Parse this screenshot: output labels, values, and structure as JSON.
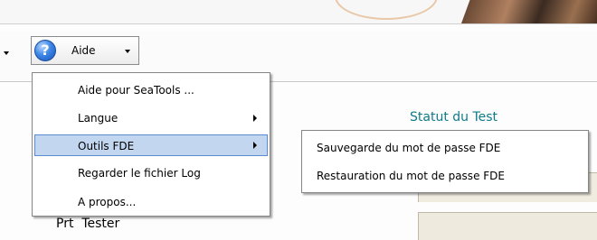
{
  "toolbar": {
    "aide_label": "Aide"
  },
  "background": {
    "status_title": "Statut du Test",
    "row_label": "Prt  Tester"
  },
  "menu": {
    "items": [
      {
        "label": "Aide pour SeaTools ...",
        "has_submenu": false
      },
      {
        "label": "Langue",
        "has_submenu": true
      },
      {
        "label": "Outils FDE",
        "has_submenu": true,
        "highlighted": true
      },
      {
        "label": "Regarder le fichier Log",
        "has_submenu": false
      },
      {
        "label": "A propos...",
        "has_submenu": false
      }
    ]
  },
  "submenu": {
    "items": [
      {
        "label": "Sauvegarde du mot de passe FDE"
      },
      {
        "label": "Restauration du mot de passe FDE"
      }
    ]
  },
  "icons": {
    "help": "help-question-icon",
    "submenu_arrow": "chevron-right-icon",
    "dropdown_arrow": "chevron-down-icon"
  },
  "colors": {
    "highlight_bg": "#c2d6f0",
    "highlight_border": "#5a8ad0",
    "status_text": "#0f7a8a"
  }
}
